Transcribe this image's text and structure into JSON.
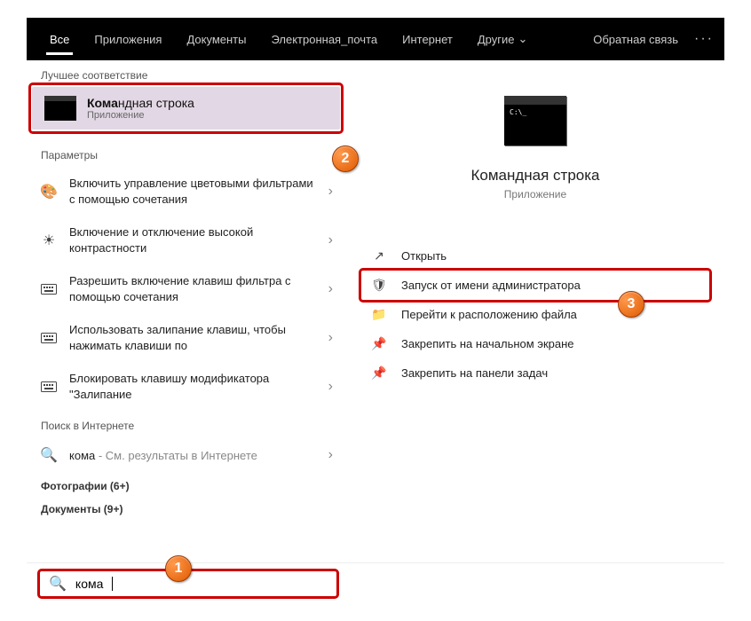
{
  "top_tabs": {
    "all": "Все",
    "apps": "Приложения",
    "docs": "Документы",
    "email": "Электронная_почта",
    "internet": "Интернет",
    "other": "Другие"
  },
  "top_right": {
    "feedback": "Обратная связь"
  },
  "sections": {
    "best_match": "Лучшее соответствие",
    "settings": "Параметры",
    "web": "Поиск в Интернете",
    "photos": "Фотографии (6+)",
    "documents": "Документы (9+)"
  },
  "best": {
    "title_prefix_bold": "Кома",
    "title_rest": "ндная строка",
    "subtitle": "Приложение"
  },
  "settings_items": [
    "Включить управление цветовыми фильтрами с помощью сочетания",
    "Включение и отключение высокой контрастности",
    "Разрешить включение клавиш фильтра с помощью сочетания",
    "Использовать залипание клавиш, чтобы нажимать клавиши по",
    "Блокировать клавишу модификатора \"Залипание"
  ],
  "web_item": {
    "query": "кома",
    "suffix": " - См. результаты в Интернете"
  },
  "preview": {
    "title": "Командная строка",
    "subtitle": "Приложение"
  },
  "actions": {
    "open": "Открыть",
    "admin": "Запуск от имени администратора",
    "location": "Перейти к расположению файла",
    "pin_start": "Закрепить на начальном экране",
    "pin_taskbar": "Закрепить на панели задач"
  },
  "search": {
    "value": "кома"
  },
  "badges": {
    "b1": "1",
    "b2": "2",
    "b3": "3"
  }
}
